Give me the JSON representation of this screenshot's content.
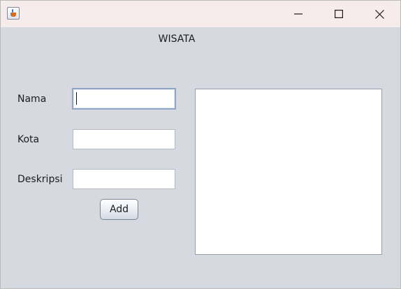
{
  "window": {
    "title": "",
    "app_icon": "java-cup-icon",
    "controls": {
      "minimize": "minimize-icon",
      "maximize": "maximize-icon",
      "close": "close-icon"
    }
  },
  "form": {
    "heading": "WISATA",
    "fields": {
      "nama": {
        "label": "Nama",
        "value": ""
      },
      "kota": {
        "label": "Kota",
        "value": ""
      },
      "deskripsi": {
        "label": "Deskripsi",
        "value": ""
      }
    },
    "add_button": "Add"
  },
  "list": {
    "items": []
  },
  "colors": {
    "window_bg": "#d6d9e0",
    "titlebar_bg": "#f7ecec",
    "focus_border": "#8ea5c6"
  }
}
